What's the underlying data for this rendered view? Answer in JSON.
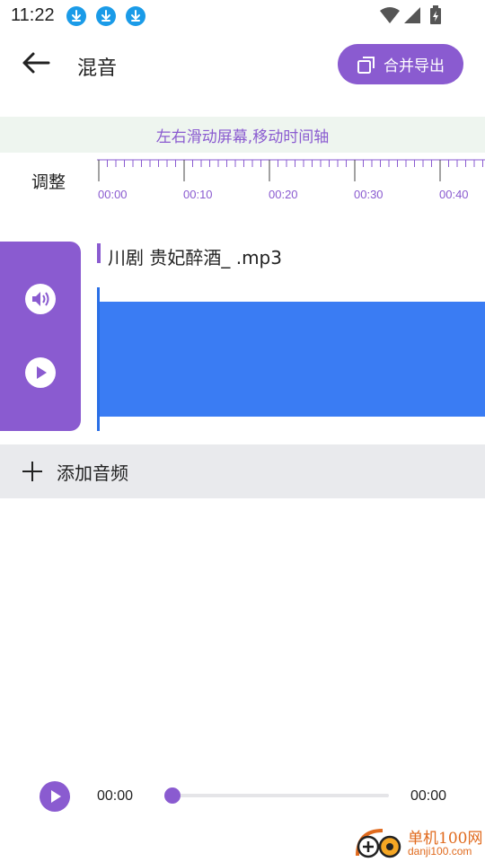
{
  "status_bar": {
    "time": "11:22",
    "notification_icons": [
      "download-icon",
      "download-icon",
      "download-icon"
    ],
    "right_icons": [
      "wifi-icon",
      "signal-icon",
      "battery-charging-icon"
    ]
  },
  "header": {
    "title": "混音",
    "merge_export_label": "合并导出"
  },
  "timeline": {
    "hint": "左右滑动屏幕,移动时间轴",
    "adjust_label": "调整",
    "tick_labels": [
      "00:00",
      "00:10",
      "00:20",
      "00:30",
      "00:40"
    ]
  },
  "track": {
    "name": "川剧 贵妃醉酒_ .mp3",
    "controls": [
      "volume-icon",
      "play-icon"
    ]
  },
  "add_audio": {
    "label": "添加音频"
  },
  "player": {
    "current_time": "00:00",
    "total_time": "00:00",
    "progress": 0
  },
  "watermark": {
    "name": "单机100网",
    "url": "danji100.com"
  },
  "colors": {
    "accent": "#8a5bd0",
    "waveform": "#3a7cf3",
    "hint_bg": "#eef5ef",
    "add_audio_bg": "#e9eaed",
    "notification_icon": "#1a9be8"
  }
}
